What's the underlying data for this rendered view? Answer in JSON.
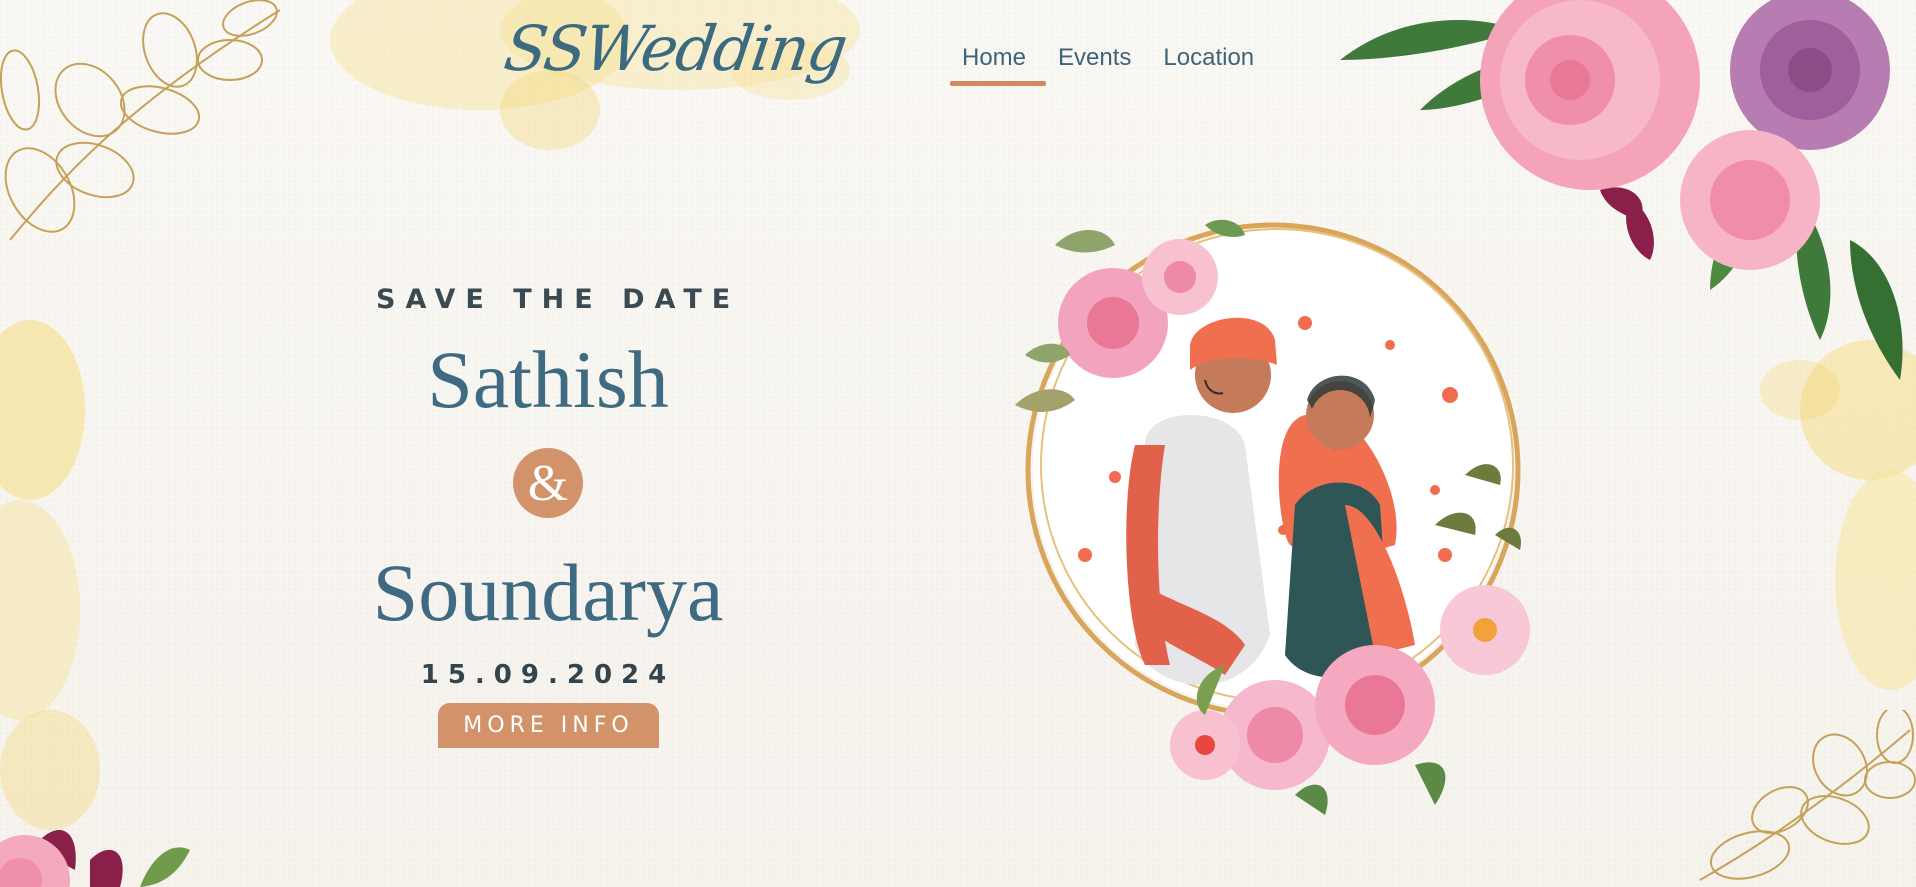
{
  "logo": "SSWedding",
  "nav": [
    {
      "label": "Home",
      "active": true
    },
    {
      "label": "Events",
      "active": false
    },
    {
      "label": "Location",
      "active": false
    }
  ],
  "hero": {
    "tagline": "SAVE THE DATE",
    "name1": "Sathish",
    "ampersand": "&",
    "name2": "Soundarya",
    "date": "15.09.2024",
    "cta": "MORE INFO"
  },
  "colors": {
    "primary": "#3e6a82",
    "accent": "#d3936a",
    "background": "#f8f6f1"
  }
}
